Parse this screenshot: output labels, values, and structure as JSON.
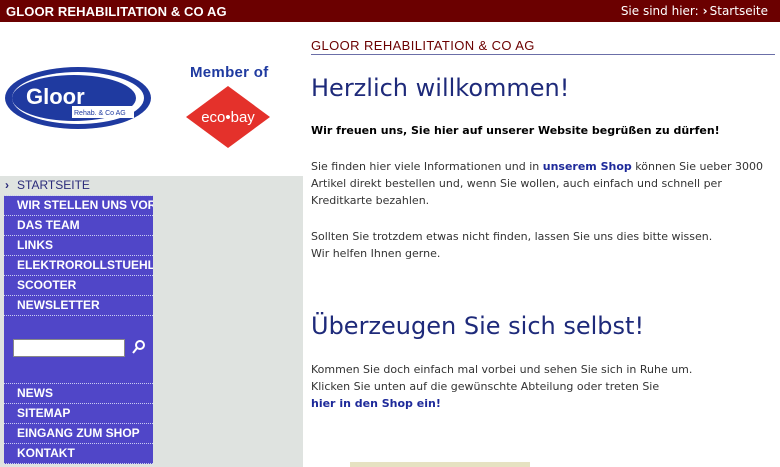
{
  "topbar": {
    "brand": "GLOOR REHABILITATION & CO AG",
    "breadcrumb_prefix": "Sie sind hier:",
    "breadcrumb_current": "Startseite"
  },
  "logos": {
    "gloor_text": "Gloor",
    "gloor_sub": "Rehab. & Co AG",
    "member_text": "Member of",
    "ecobay_text": "eco•bay"
  },
  "nav": {
    "items": [
      {
        "label": "STARTSEITE",
        "active": true
      },
      {
        "label": "WIR STELLEN UNS VOR"
      },
      {
        "label": "DAS TEAM"
      },
      {
        "label": "LINKS"
      },
      {
        "label": "ELEKTROROLLSTUEHLE"
      },
      {
        "label": "SCOOTER"
      },
      {
        "label": "NEWSLETTER"
      }
    ],
    "items_bottom": [
      {
        "label": "NEWS"
      },
      {
        "label": "SITEMAP"
      },
      {
        "label": "EINGANG ZUM SHOP"
      },
      {
        "label": "KONTAKT"
      }
    ],
    "search_placeholder": ""
  },
  "main": {
    "section_header": "GLOOR REHABILITATION & CO AG",
    "welcome_title": "Herzlich willkommen!",
    "lead": "Wir freuen uns, Sie hier auf unserer Website begrüßen zu dürfen!",
    "p1_a": "Sie finden hier viele Informationen und in ",
    "p1_link": "unserem Shop",
    "p1_b": " können Sie ueber 3000 Artikel direkt bestellen und, wenn Sie wollen, auch einfach und schnell per Kreditkarte bezahlen.",
    "p2_line1": "Sollten Sie trotzdem etwas nicht finden, lassen Sie uns dies bitte wissen.",
    "p2_line2": "Wir helfen Ihnen gerne.",
    "convince_title": "Überzeugen Sie sich selbst!",
    "p3_line1": "Kommen Sie doch einfach mal vorbei und sehen Sie sich in Ruhe um.",
    "p3_line2": "Klicken Sie unten auf die gewünschte Abteilung oder treten Sie",
    "p3_link": "hier in den Shop ein!"
  },
  "colors": {
    "topbar": "#6b0000",
    "nav_bg": "#5046c8",
    "sidebar_bg": "#dfe3e0",
    "heading": "#1e2a7a",
    "link": "#1e2a9a"
  }
}
